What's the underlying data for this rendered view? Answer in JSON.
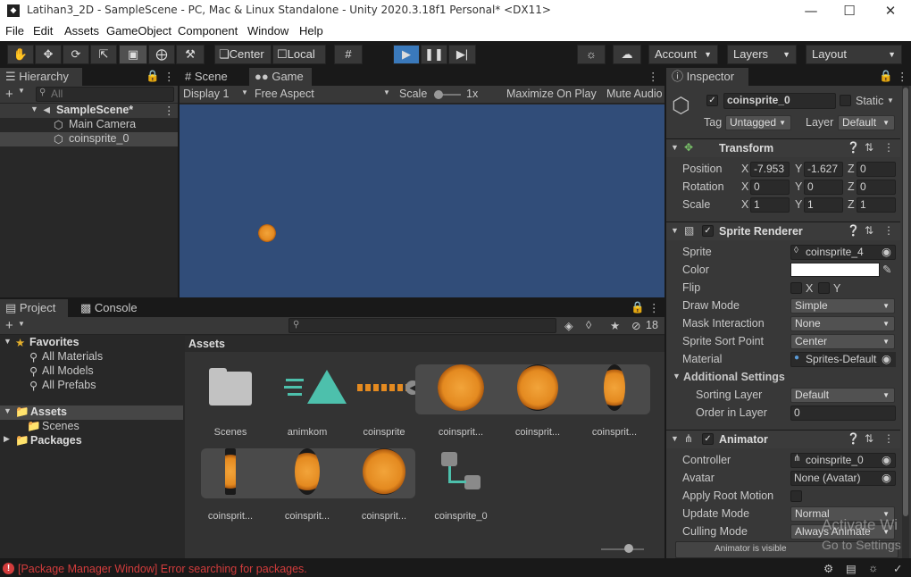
{
  "window": {
    "title": "Latihan3_2D - SampleScene - PC, Mac & Linux Standalone - Unity 2020.3.18f1 Personal* <DX11>",
    "app_icon": "◆"
  },
  "menu": [
    "File",
    "Edit",
    "Assets",
    "GameObject",
    "Component",
    "Window",
    "Help"
  ],
  "toolbar": {
    "pivot_label": "Center",
    "space_label": "Local",
    "account_label": "Account",
    "layers_label": "Layers",
    "layout_label": "Layout"
  },
  "hierarchy": {
    "tab_label": "Hierarchy",
    "add_label": "+",
    "search_placeholder": "All",
    "scene_name": "SampleScene*",
    "items": [
      "Main Camera",
      "coinsprite_0"
    ]
  },
  "scene_view": {
    "tabs": [
      "Scene",
      "Game"
    ],
    "display": "Display 1",
    "aspect": "Free Aspect",
    "scale_label": "Scale",
    "scale_value": "1x",
    "maximize_label": "Maximize On Play",
    "mute_label": "Mute Audio",
    "bg_color": "#314d79"
  },
  "project": {
    "tabs": [
      "Project",
      "Console"
    ],
    "favorites_label": "Favorites",
    "favorites": [
      "All Materials",
      "All Models",
      "All Prefabs"
    ],
    "assets_label": "Assets",
    "assets_children": [
      "Scenes"
    ],
    "packages_label": "Packages",
    "breadcrumb": "Assets",
    "hidden_count": "18",
    "assets_row1": [
      "Scenes",
      "animkom",
      "coinsprite",
      "coinsprit...",
      "coinsprit...",
      "coinsprit..."
    ],
    "assets_row2": [
      "coinsprit...",
      "coinsprit...",
      "coinsprit...",
      "coinsprite_0"
    ]
  },
  "inspector": {
    "tab_label": "Inspector",
    "object_name": "coinsprite_0",
    "static_label": "Static",
    "tag_label": "Tag",
    "tag_value": "Untagged",
    "layer_label": "Layer",
    "layer_value": "Default",
    "transform": {
      "label": "Transform",
      "position_label": "Position",
      "rotation_label": "Rotation",
      "scale_label": "Scale",
      "position": [
        "-7.953",
        "-1.627",
        "0"
      ],
      "rotation": [
        "0",
        "0",
        "0"
      ],
      "scale": [
        "1",
        "1",
        "1"
      ]
    },
    "sprite_renderer": {
      "label": "Sprite Renderer",
      "sprite_label": "Sprite",
      "sprite_value": "coinsprite_4",
      "color_label": "Color",
      "flip_label": "Flip",
      "flip_x": "X",
      "flip_y": "Y",
      "draw_mode_label": "Draw Mode",
      "draw_mode_value": "Simple",
      "mask_label": "Mask Interaction",
      "mask_value": "None",
      "sort_point_label": "Sprite Sort Point",
      "sort_point_value": "Center",
      "material_label": "Material",
      "material_value": "Sprites-Default",
      "additional_label": "Additional Settings",
      "sorting_layer_label": "Sorting Layer",
      "sorting_layer_value": "Default",
      "order_label": "Order in Layer",
      "order_value": "0"
    },
    "animator": {
      "label": "Animator",
      "controller_label": "Controller",
      "controller_value": "coinsprite_0",
      "avatar_label": "Avatar",
      "avatar_value": "None (Avatar)",
      "root_motion_label": "Apply Root Motion",
      "update_label": "Update Mode",
      "update_value": "Normal",
      "culling_label": "Culling Mode",
      "culling_value": "Always Animate",
      "info": "Animator is visible"
    }
  },
  "status": {
    "error_text": "[Package Manager Window] Error searching for packages.",
    "watermark_line1": "Activate Wi",
    "watermark_line2": "Go to Settings",
    "error_color": "#d23c3c"
  }
}
